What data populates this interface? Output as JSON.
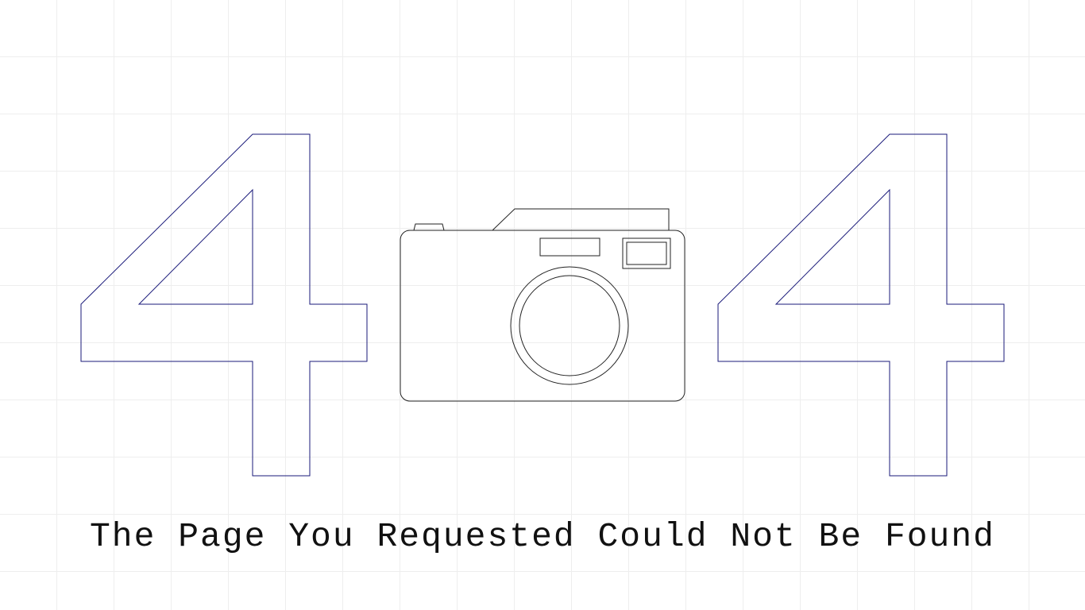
{
  "error": {
    "code_left_digit": "4",
    "code_right_digit": "4",
    "message": "The Page You Requested Could Not Be Found"
  },
  "icons": {
    "center": "camera-icon"
  },
  "colors": {
    "digit_stroke": "#1a1a7a",
    "camera_stroke": "#222222",
    "grid": "#eeeeee",
    "background": "#ffffff",
    "text": "#111111"
  }
}
